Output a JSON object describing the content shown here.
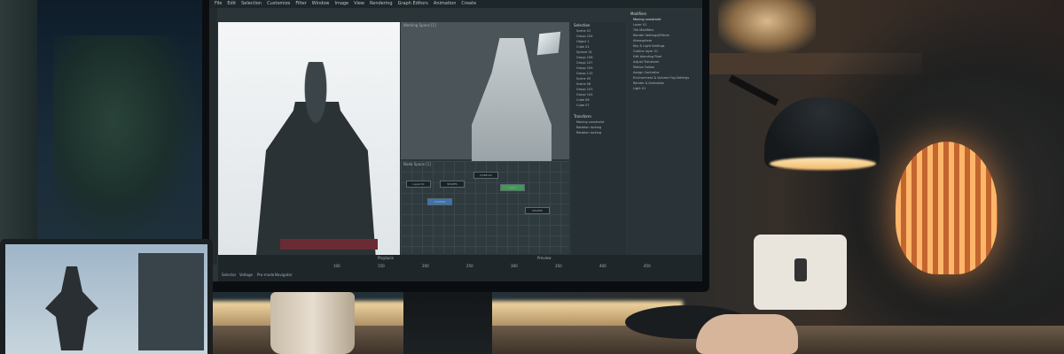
{
  "menu": {
    "items": [
      "File",
      "Edit",
      "Selection",
      "Customize",
      "Filter",
      "Window",
      "Image",
      "View",
      "Rendering",
      "Graph Editors",
      "Animation",
      "Create"
    ]
  },
  "viewport": {
    "working_space_label": "Working Space [1]",
    "node_space_label": "Node Space [1]"
  },
  "outliner": {
    "title": "Selection",
    "rows": [
      "Scene 01",
      "Group 104",
      "Object 1",
      "Cube 01",
      "Sphere 01",
      "Group 106",
      "Group 107",
      "Group 109",
      "Group 110",
      "Scene 05",
      "Scene 06",
      "Group 103",
      "Group 104",
      "Cube 06",
      "Cube 07"
    ]
  },
  "props": {
    "title": "Modifiers",
    "header": "Moving constraint",
    "items": [
      "Layer 01",
      "Tile Modifiers",
      "Render Settings/Effects",
      "Atmosphere",
      "Key & Light Settings",
      "Outline layer 01",
      "Edit blending Pixel",
      "Adjust Transform",
      "Motion Follow",
      "Assign Controller",
      "Environment & Volume Fog Settings",
      "Render & Animation",
      "Light 01"
    ]
  },
  "transform": {
    "title": "Transform",
    "rows": [
      "Moving constraint",
      "Rotation locking",
      "Rotation locking"
    ]
  },
  "bottom": {
    "playback": "Playback",
    "preview": "Preview",
    "tools": [
      "Selector",
      "Voltage",
      "Pro-mode",
      "Navigator"
    ],
    "ruler": [
      "100",
      "150",
      "200",
      "250",
      "300",
      "350",
      "400",
      "450"
    ]
  },
  "nodes": [
    "Layer.txt",
    "SHAPES",
    "CORE.txt",
    "Color",
    "SCREEN",
    "SHAPES"
  ],
  "colors": {
    "accent_green": "#3f9b4e",
    "accent_blue": "#3d73b0",
    "ui_dark": "#2b3439"
  }
}
